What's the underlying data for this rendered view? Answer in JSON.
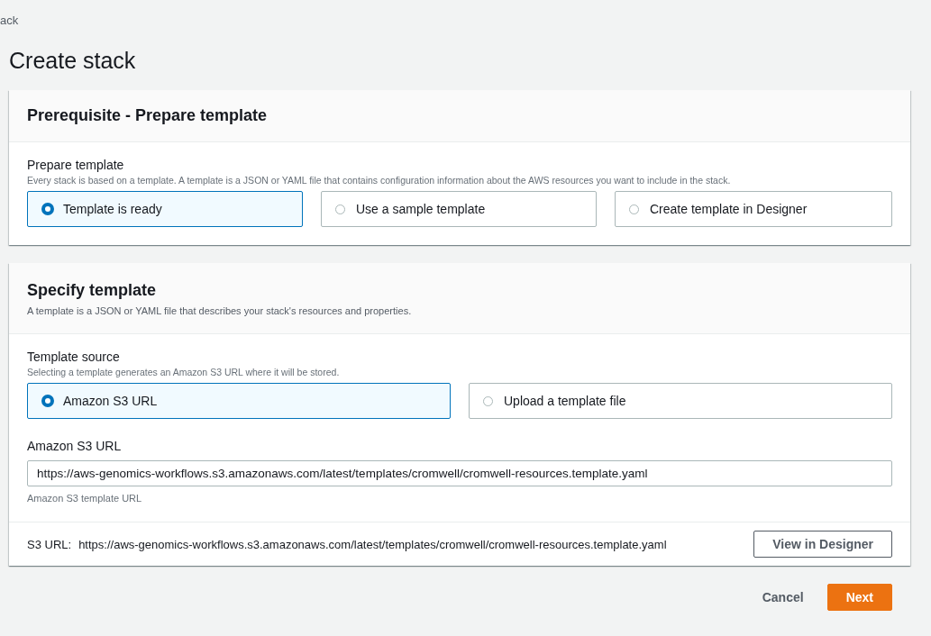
{
  "breadcrumb": "ack",
  "page_title": "Create stack",
  "prerequisite": {
    "title": "Prerequisite - Prepare template",
    "field_label": "Prepare template",
    "field_description": "Every stack is based on a template. A template is a JSON or YAML file that contains configuration information about the AWS resources you want to include in the stack.",
    "options": [
      {
        "label": "Template is ready",
        "selected": true
      },
      {
        "label": "Use a sample template",
        "selected": false
      },
      {
        "label": "Create template in Designer",
        "selected": false
      }
    ]
  },
  "specify": {
    "title": "Specify template",
    "description": "A template is a JSON or YAML file that describes your stack's resources and properties.",
    "field_label": "Template source",
    "field_description": "Selecting a template generates an Amazon S3 URL where it will be stored.",
    "options": [
      {
        "label": "Amazon S3 URL",
        "selected": true
      },
      {
        "label": "Upload a template file",
        "selected": false
      }
    ],
    "url_label": "Amazon S3 URL",
    "url_value": "https://aws-genomics-workflows.s3.amazonaws.com/latest/templates/cromwell/cromwell-resources.template.yaml",
    "url_hint": "Amazon S3 template URL",
    "footer_label": "S3 URL:",
    "footer_url": "https://aws-genomics-workflows.s3.amazonaws.com/latest/templates/cromwell/cromwell-resources.template.yaml",
    "footer_button": "View in Designer"
  },
  "buttons": {
    "cancel": "Cancel",
    "next": "Next"
  }
}
